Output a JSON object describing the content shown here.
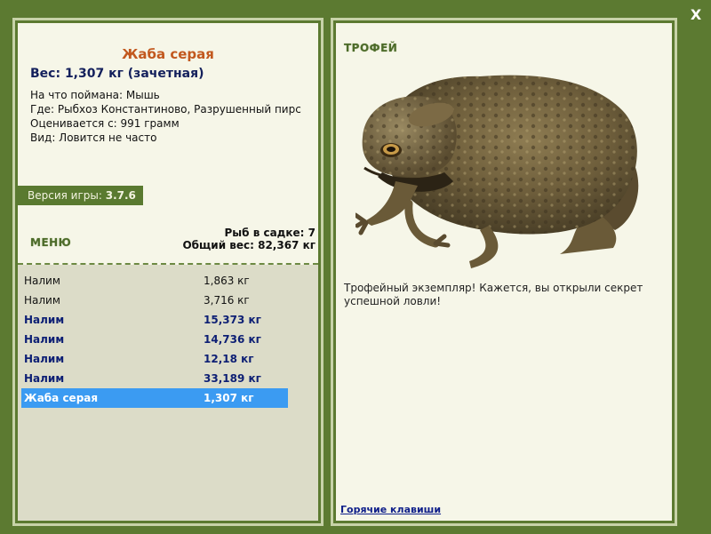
{
  "close_label": "X",
  "fish": {
    "title": "Жаба серая",
    "weight_line": "Вес: 1,307 кг (зачетная)",
    "bait_line": "На что поймана: Мышь",
    "place_line": "Где: Рыбхоз Константиново, Разрушенный пирс",
    "value_line": "Оценивается с: 991 грамм",
    "kind_line": "Вид: Ловится не часто"
  },
  "version": {
    "label": "Версия игры:",
    "value": "3.7.6"
  },
  "menu_label": "МЕНЮ",
  "stats": {
    "count_line": "Рыб в садке: 7",
    "total_line": "Общий вес: 82,367 кг"
  },
  "catch_list": [
    {
      "name": "Налим",
      "weight": "1,863 кг",
      "style": "normal"
    },
    {
      "name": "Налим",
      "weight": "3,716 кг",
      "style": "normal"
    },
    {
      "name": "Налим",
      "weight": "15,373 кг",
      "style": "bold"
    },
    {
      "name": "Налим",
      "weight": "14,736 кг",
      "style": "bold"
    },
    {
      "name": "Налим",
      "weight": "12,18 кг",
      "style": "bold"
    },
    {
      "name": "Налим",
      "weight": "33,189 кг",
      "style": "bold"
    },
    {
      "name": "Жаба серая",
      "weight": "1,307 кг",
      "style": "selected"
    }
  ],
  "trophy": {
    "label": "ТРОФЕЙ",
    "text": "Трофейный экземпляр! Кажется, вы открыли секрет успешной ловли!"
  },
  "hotkeys_label": "Горячие клавиши",
  "colors": {
    "frame_green": "#5c7a31",
    "panel_bg": "#f6f6e8",
    "list_bg": "#dcdcc8",
    "title_orange": "#c2581e",
    "bold_navy": "#0d1f74",
    "selection_blue": "#3b9bf2"
  }
}
